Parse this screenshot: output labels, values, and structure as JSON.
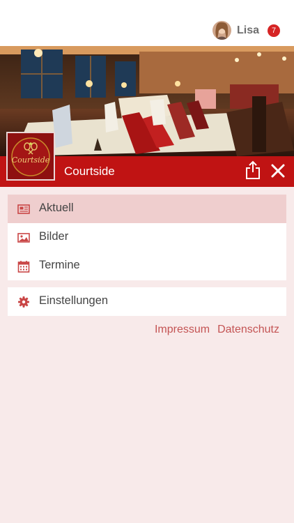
{
  "user": {
    "name": "Lisa",
    "notification_count": "7"
  },
  "club": {
    "name": "Courtside",
    "logo_text": "Courtside"
  },
  "icons": {
    "share": "share-icon",
    "close": "close-icon",
    "news": "newspaper-icon",
    "images": "image-icon",
    "calendar": "calendar-icon",
    "settings": "gear-icon"
  },
  "menu": {
    "items": [
      {
        "label": "Aktuell",
        "active": true
      },
      {
        "label": "Bilder",
        "active": false
      },
      {
        "label": "Termine",
        "active": false
      }
    ],
    "settings_label": "Einstellungen"
  },
  "footer_links": {
    "impressum": "Impressum",
    "datenschutz": "Datenschutz"
  },
  "colors": {
    "brand_red": "#c01313",
    "background": "#f8eaea",
    "badge": "#d62424",
    "link": "#c45454",
    "active_item": "#efcece"
  }
}
